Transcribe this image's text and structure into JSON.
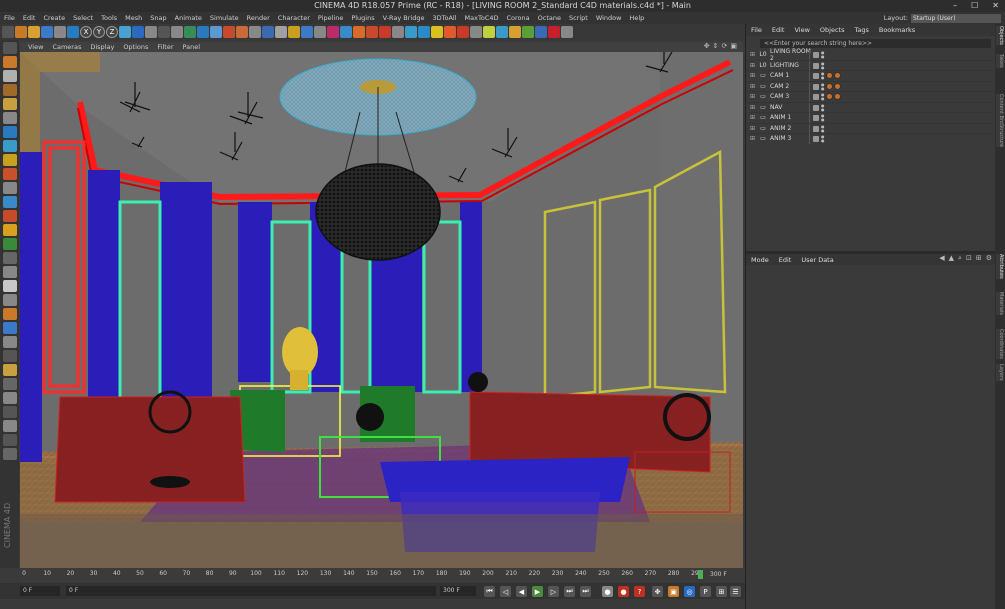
{
  "window": {
    "title": "CINEMA 4D R18.057 Prime (RC - R18) - [LIVING ROOM 2_Standard C4D materials.c4d *] - Main",
    "min": "–",
    "max": "☐",
    "close": "✕"
  },
  "menu": [
    "File",
    "Edit",
    "Create",
    "Select",
    "Tools",
    "Mesh",
    "Snap",
    "Animate",
    "Simulate",
    "Render",
    "Character",
    "Pipeline",
    "Plugins",
    "V-Ray Bridge",
    "3DToAll",
    "MaxToC4D",
    "Corona",
    "Octane",
    "Script",
    "Window",
    "Help"
  ],
  "layout": {
    "label": "Layout:",
    "value": "Startup (User)"
  },
  "toolbar": {
    "axes": [
      "X",
      "Y",
      "Z"
    ]
  },
  "viewport": {
    "menu": [
      "View",
      "Cameras",
      "Display",
      "Options",
      "Filter",
      "Panel"
    ]
  },
  "timeline": {
    "ticks": [
      "0",
      "10",
      "20",
      "30",
      "40",
      "50",
      "60",
      "70",
      "80",
      "90",
      "100",
      "110",
      "120",
      "130",
      "140",
      "150",
      "160",
      "170",
      "180",
      "190",
      "200",
      "210",
      "220",
      "230",
      "240",
      "250",
      "260",
      "270",
      "280",
      "290"
    ],
    "end": "300 F"
  },
  "transport": {
    "start": "0 F",
    "current": "0 F",
    "max": "300 F",
    "max2": "300 F"
  },
  "objects": {
    "menu": [
      "File",
      "Edit",
      "View",
      "Objects",
      "Tags",
      "Bookmarks"
    ],
    "search": "<<Enter your search string here>>",
    "rows": [
      {
        "name": "LIVING ROOM 2",
        "icon": "L0",
        "tag": false
      },
      {
        "name": "LIGHTING",
        "icon": "L0",
        "tag": false
      },
      {
        "name": "CAM 1",
        "icon": "▭",
        "tag": true
      },
      {
        "name": "CAM 2",
        "icon": "▭",
        "tag": true
      },
      {
        "name": "CAM 3",
        "icon": "▭",
        "tag": true
      },
      {
        "name": "NAV",
        "icon": "▭",
        "tag": false
      },
      {
        "name": "ANIM 1",
        "icon": "▭",
        "tag": false
      },
      {
        "name": "ANIM 2",
        "icon": "▭",
        "tag": false
      },
      {
        "name": "ANIM 3",
        "icon": "▭",
        "tag": false
      }
    ]
  },
  "attributes": {
    "menu": [
      "Mode",
      "Edit",
      "User Data"
    ]
  },
  "side_tabs": [
    "Objects",
    "Takes",
    "Content Browser",
    "Structure",
    "Attributes",
    "Materials",
    "Coordinates",
    "Layers"
  ],
  "brand": "CINEMA 4D"
}
